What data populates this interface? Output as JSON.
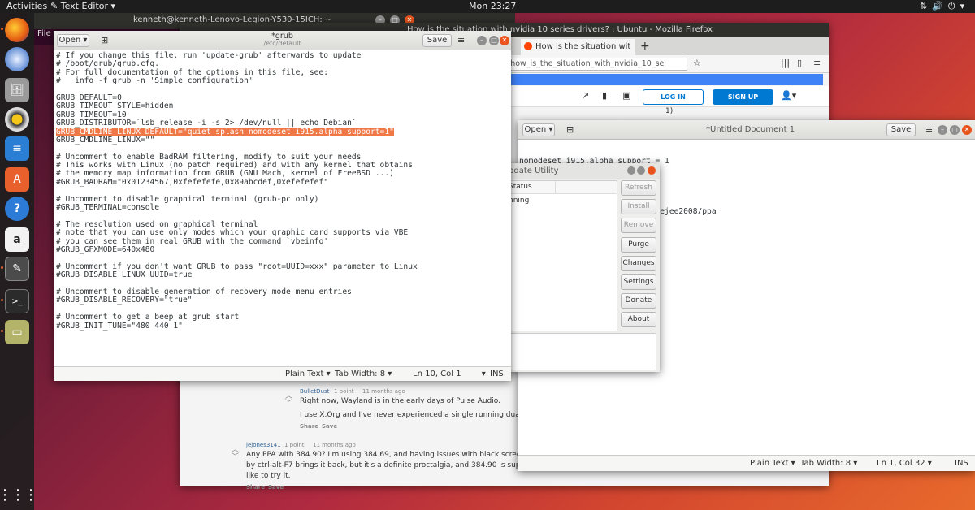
{
  "topbar": {
    "activities": "Activities",
    "app_menu": "Text Editor",
    "clock": "Mon 23:27"
  },
  "terminal": {
    "title": "kenneth@kenneth-Lenovo-Legion-Y530-15ICH: ~",
    "menu_file": "File"
  },
  "firefox": {
    "title": "How is the situation with nvidia 10 series drivers? : Ubuntu - Mozilla Firefox",
    "tab_label": "How is the situation wit",
    "new_tab": "+",
    "url": "/how_is_the_situation_with_nvidia_10_se",
    "login": "LOG IN",
    "signup": "SIGN UP",
    "fragment_1": "1)",
    "comments": [
      {
        "user": "BulletDust",
        "points": "1 point",
        "age": "11 months ago",
        "text1": "Right now, Wayland is in the early days of Pulse Audio.",
        "text2": "I use X.Org and I've never experienced a single running dual 10",
        "share": "Share",
        "save": "Save"
      },
      {
        "user": "jejones3141",
        "points": "1 point",
        "age": "11 months ago",
        "text1": "Any PPA with 384.90? I'm using 384.69, and having issues with black screen afte",
        "text2": "by ctrl-alt-F7 brings it back, but it's a definite proctalgia, and 384.90 is supposed",
        "text3": "like to try it.",
        "share": "Share",
        "save": "Save"
      }
    ]
  },
  "untitled": {
    "open": "Open",
    "title": "*Untitled Document 1",
    "save": "Save",
    "lines": [
      "nomodeset i915.alpha_support = 1",
      "",
      "sudo add-apt-repository ppa:teejee2008/ppa"
    ],
    "status_lang": "Plain Text",
    "status_tab": "Tab Width: 8",
    "status_pos": "Ln 1, Col 32",
    "status_ins": "INS"
  },
  "update": {
    "title": "pdate Utility",
    "col_status": "Status",
    "row_status": "nning",
    "buttons": [
      "Refresh",
      "Install",
      "Remove",
      "Purge",
      "Changes",
      "Settings",
      "Donate",
      "About"
    ]
  },
  "grub": {
    "open": "Open",
    "title": "*grub",
    "subtitle": "/etc/default",
    "save": "Save",
    "lines": [
      "# If you change this file, run 'update-grub' afterwards to update",
      "# /boot/grub/grub.cfg.",
      "# For full documentation of the options in this file, see:",
      "#   info -f grub -n 'Simple configuration'",
      "",
      "GRUB_DEFAULT=0",
      "GRUB_TIMEOUT_STYLE=hidden",
      "GRUB_TIMEOUT=10",
      "GRUB_DISTRIBUTOR=`lsb_release -i -s 2> /dev/null || echo Debian`",
      "GRUB_CMDLINE_LINUX_DEFAULT=\"quiet splash nomodeset i915.alpha_support=1\"",
      "GRUB_CMDLINE_LINUX=\"\"",
      "",
      "# Uncomment to enable BadRAM filtering, modify to suit your needs",
      "# This works with Linux (no patch required) and with any kernel that obtains",
      "# the memory map information from GRUB (GNU Mach, kernel of FreeBSD ...)",
      "#GRUB_BADRAM=\"0x01234567,0xfefefefe,0x89abcdef,0xefefefef\"",
      "",
      "# Uncomment to disable graphical terminal (grub-pc only)",
      "#GRUB_TERMINAL=console",
      "",
      "# The resolution used on graphical terminal",
      "# note that you can use only modes which your graphic card supports via VBE",
      "# you can see them in real GRUB with the command `vbeinfo'",
      "#GRUB_GFXMODE=640x480",
      "",
      "# Uncomment if you don't want GRUB to pass \"root=UUID=xxx\" parameter to Linux",
      "#GRUB_DISABLE_LINUX_UUID=true",
      "",
      "# Uncomment to disable generation of recovery mode menu entries",
      "#GRUB_DISABLE_RECOVERY=\"true\"",
      "",
      "# Uncomment to get a beep at grub start",
      "#GRUB_INIT_TUNE=\"480 440 1\""
    ],
    "highlight_index": 9,
    "status_lang": "Plain Text",
    "status_tab": "Tab Width: 8",
    "status_pos": "Ln 10, Col 1",
    "status_ins": "INS"
  },
  "dock_icons": [
    "firefox-icon",
    "thunderbird-icon",
    "files-icon",
    "rhythmbox-icon",
    "writer-icon",
    "software-icon",
    "help-icon",
    "amazon-icon",
    "text-editor-icon",
    "terminal-icon",
    "archive-icon",
    "app-grid-icon"
  ]
}
